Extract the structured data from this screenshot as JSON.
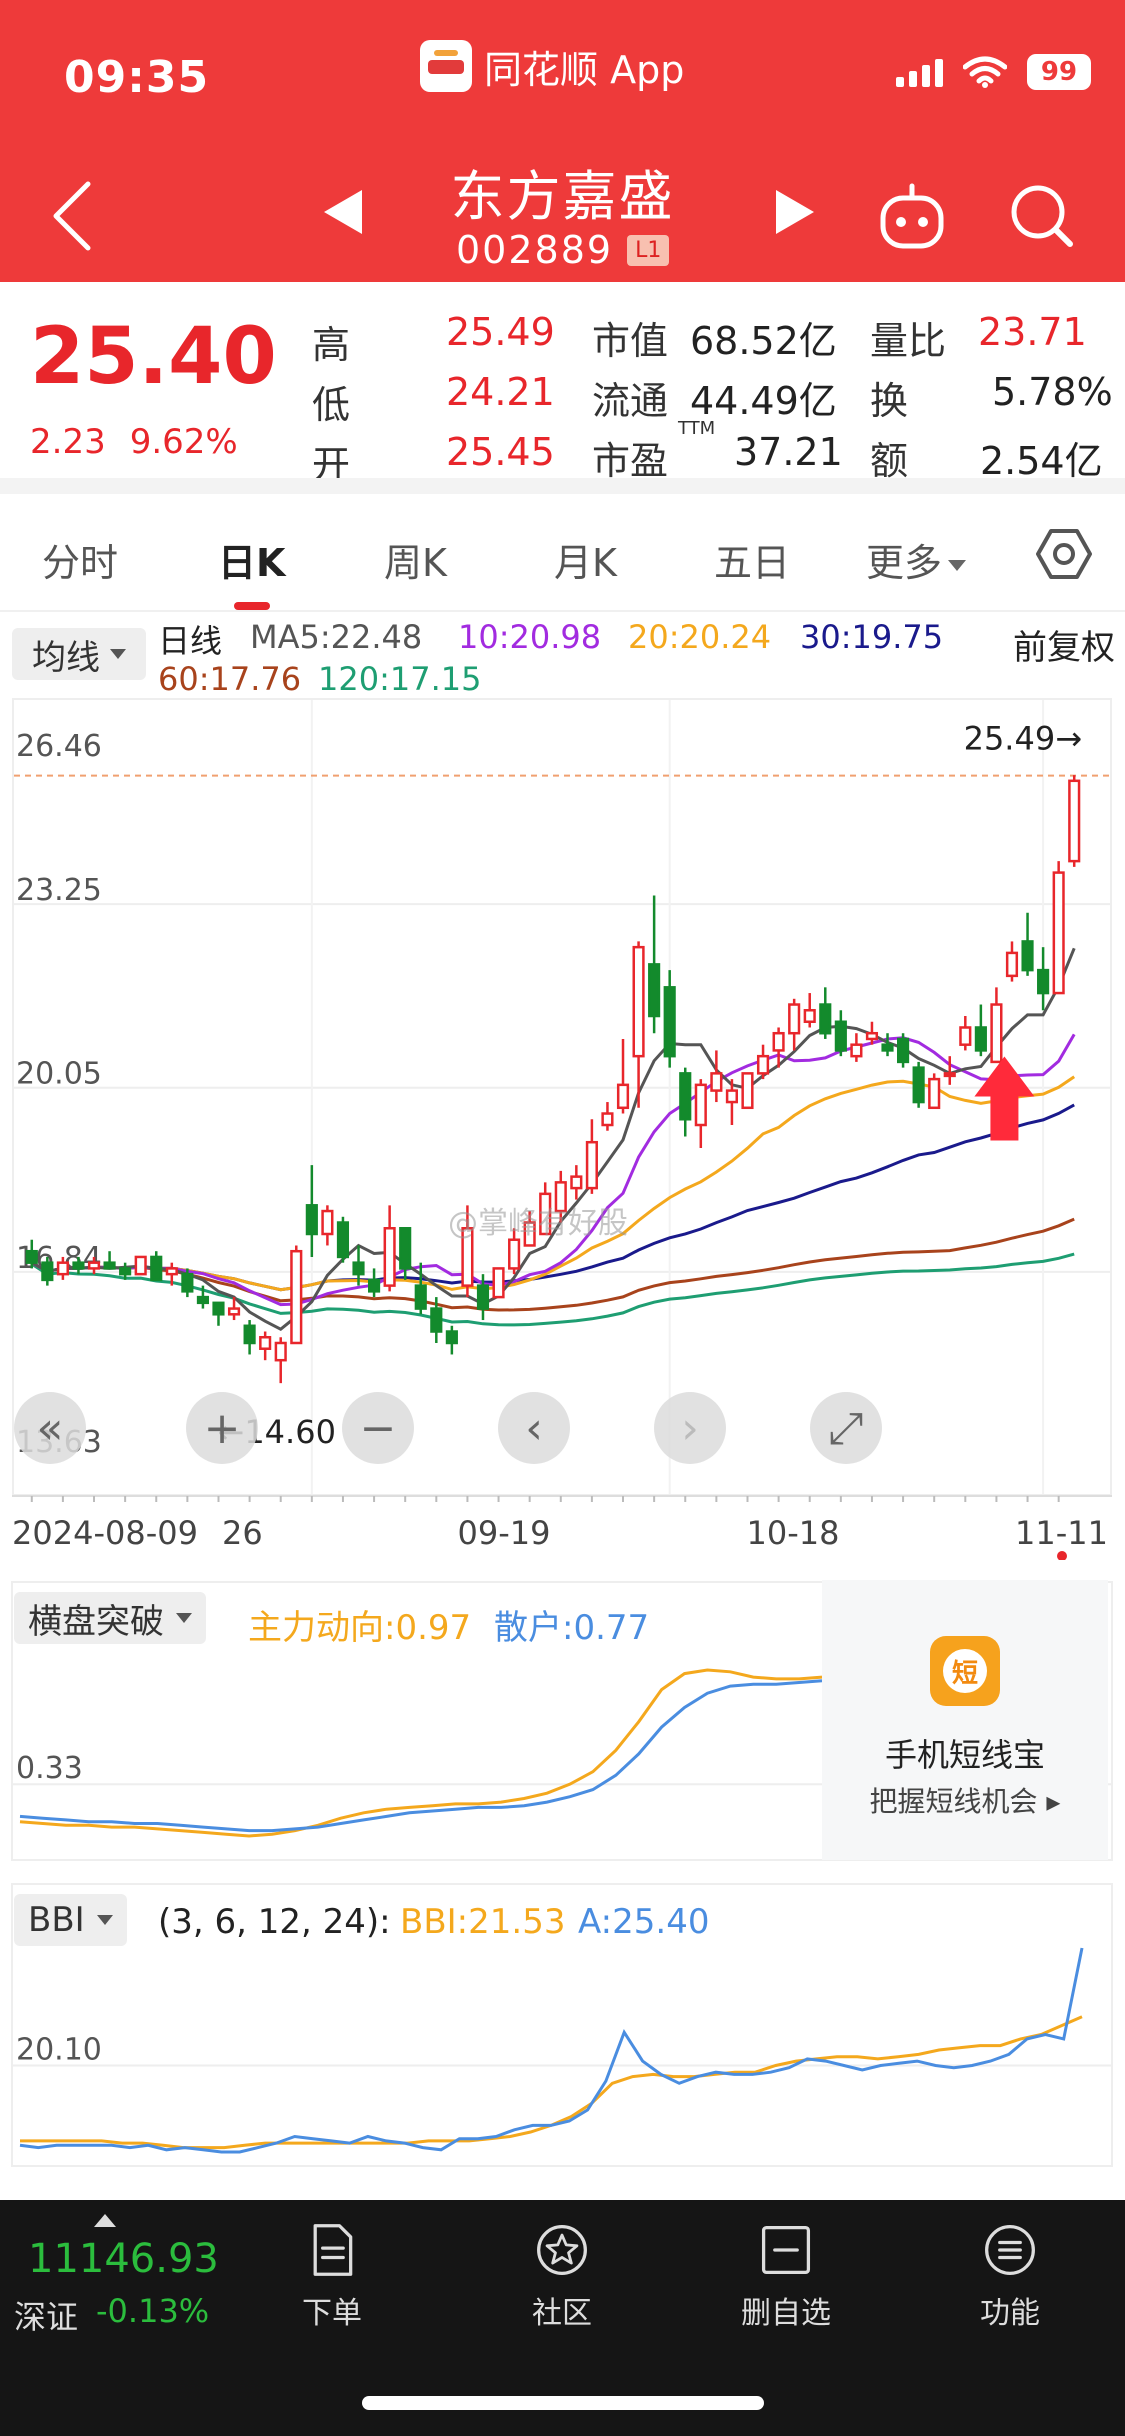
{
  "status": {
    "time": "09:35",
    "app_name": "同花顺 App",
    "battery": "99"
  },
  "stock": {
    "name": "东方嘉盛",
    "code": "002889",
    "level": "L1"
  },
  "quote": {
    "price": "25.40",
    "change": "2.23",
    "change_pct": "9.62%",
    "high_label": "高",
    "high": "25.49",
    "low_label": "低",
    "low": "24.21",
    "open_label": "开",
    "open": "25.45",
    "mktcap_label": "市值",
    "mktcap": "68.52亿",
    "float_label": "流通",
    "float": "44.49亿",
    "pe_label": "市盈",
    "pe_sup": "TTM",
    "pe": "37.21",
    "vol_ratio_label": "量比",
    "vol_ratio": "23.71",
    "turnover_label": "换",
    "turnover": "5.78%",
    "amount_label": "额",
    "amount": "2.54亿"
  },
  "tabs": [
    "分时",
    "日K",
    "周K",
    "月K",
    "五日",
    "更多"
  ],
  "active_tab": "日K",
  "ma_legend": {
    "selector": "均线",
    "period": "日线",
    "ma5": "MA5:22.48",
    "ma10": "10:20.98",
    "ma20": "20:20.24",
    "ma30": "30:19.75",
    "ma60": "60:17.76",
    "ma120": "120:17.15",
    "adjust": "前复权"
  },
  "colors": {
    "up": "#e8262b",
    "down": "#138a2c",
    "ma5": "#555555",
    "ma10": "#a22be0",
    "ma20": "#f4a81d",
    "ma30": "#1a1a8c",
    "ma60": "#a8431c",
    "ma120": "#1e9e72"
  },
  "chart_data": [
    {
      "type": "candlestick",
      "title": "",
      "y_ticks": [
        "26.46",
        "23.25",
        "20.05",
        "16.84",
        "13.63"
      ],
      "ylim": [
        13.63,
        26.46
      ],
      "x_labels": [
        "2024-08-09",
        "26",
        "09-19",
        "10-18",
        "11-11"
      ],
      "max_label": "25.49→",
      "min_label": "←14.60",
      "candles": [
        [
          17.2,
          17.4,
          16.9,
          17.0
        ],
        [
          17.0,
          17.1,
          16.6,
          16.7
        ],
        [
          16.8,
          17.1,
          16.7,
          17.0
        ],
        [
          17.0,
          17.1,
          16.8,
          16.9
        ],
        [
          16.9,
          17.1,
          16.8,
          17.0
        ],
        [
          17.0,
          17.2,
          16.9,
          16.9
        ],
        [
          16.9,
          17.0,
          16.7,
          16.8
        ],
        [
          16.8,
          17.1,
          16.8,
          17.1
        ],
        [
          17.1,
          17.2,
          16.7,
          16.7
        ],
        [
          16.8,
          17.0,
          16.6,
          16.9
        ],
        [
          16.8,
          16.9,
          16.4,
          16.5
        ],
        [
          16.4,
          16.6,
          16.2,
          16.3
        ],
        [
          16.3,
          16.3,
          15.9,
          16.1
        ],
        [
          16.1,
          16.4,
          16.0,
          16.2
        ],
        [
          15.9,
          16.0,
          15.4,
          15.6
        ],
        [
          15.5,
          15.8,
          15.3,
          15.7
        ],
        [
          15.3,
          15.7,
          14.9,
          15.6
        ],
        [
          15.6,
          17.3,
          15.6,
          17.2
        ],
        [
          18.0,
          18.7,
          17.1,
          17.5
        ],
        [
          17.5,
          18.0,
          17.3,
          17.9
        ],
        [
          17.7,
          17.8,
          17.0,
          17.1
        ],
        [
          17.0,
          17.3,
          16.6,
          16.8
        ],
        [
          16.7,
          16.9,
          16.4,
          16.5
        ],
        [
          16.6,
          18.0,
          16.5,
          17.6
        ],
        [
          17.6,
          17.6,
          16.7,
          16.9
        ],
        [
          16.6,
          17.0,
          16.1,
          16.2
        ],
        [
          16.2,
          16.4,
          15.6,
          15.8
        ],
        [
          15.8,
          15.9,
          15.4,
          15.6
        ],
        [
          16.6,
          18.0,
          16.4,
          17.6
        ],
        [
          16.6,
          16.8,
          16.0,
          16.2
        ],
        [
          16.4,
          16.9,
          16.4,
          16.9
        ],
        [
          16.9,
          17.6,
          16.8,
          17.4
        ],
        [
          17.3,
          17.9,
          17.3,
          17.7
        ],
        [
          17.5,
          18.4,
          17.5,
          18.2
        ],
        [
          17.9,
          18.6,
          17.7,
          18.4
        ],
        [
          18.3,
          18.7,
          18.1,
          18.5
        ],
        [
          18.3,
          19.5,
          18.2,
          19.1
        ],
        [
          19.4,
          19.8,
          19.3,
          19.6
        ],
        [
          19.7,
          20.9,
          19.6,
          20.1
        ],
        [
          20.6,
          22.6,
          19.7,
          22.5
        ],
        [
          22.2,
          23.4,
          21.0,
          21.3
        ],
        [
          21.8,
          22.1,
          20.4,
          20.6
        ],
        [
          20.3,
          20.4,
          19.2,
          19.5
        ],
        [
          19.4,
          20.2,
          19.0,
          20.1
        ],
        [
          20.0,
          20.7,
          19.8,
          20.3
        ],
        [
          19.8,
          20.2,
          19.4,
          20.0
        ],
        [
          19.7,
          20.3,
          19.7,
          20.3
        ],
        [
          20.3,
          20.8,
          20.2,
          20.6
        ],
        [
          20.7,
          21.1,
          20.4,
          21.0
        ],
        [
          21.0,
          21.6,
          20.7,
          21.5
        ],
        [
          21.2,
          21.7,
          21.1,
          21.4
        ],
        [
          21.5,
          21.8,
          20.9,
          21.0
        ],
        [
          21.2,
          21.4,
          20.6,
          20.7
        ],
        [
          20.6,
          21.0,
          20.5,
          20.8
        ],
        [
          20.9,
          21.2,
          20.8,
          21.0
        ],
        [
          20.8,
          21.0,
          20.6,
          20.7
        ],
        [
          20.9,
          21.0,
          20.4,
          20.5
        ],
        [
          20.4,
          20.5,
          19.7,
          19.8
        ],
        [
          19.7,
          20.3,
          19.7,
          20.2
        ],
        [
          20.3,
          20.6,
          20.1,
          20.3
        ],
        [
          20.8,
          21.3,
          20.7,
          21.1
        ],
        [
          21.1,
          21.5,
          20.6,
          20.7
        ],
        [
          20.5,
          21.8,
          20.5,
          21.5
        ],
        [
          22.0,
          22.6,
          21.9,
          22.4
        ],
        [
          22.6,
          23.1,
          22.0,
          22.1
        ],
        [
          22.1,
          22.5,
          21.4,
          21.7
        ],
        [
          21.7,
          24.0,
          21.7,
          23.8
        ],
        [
          24.0,
          25.5,
          23.9,
          25.4
        ]
      ],
      "ma_last": {
        "MA5": 22.48,
        "MA10": 20.98,
        "MA20": 20.24,
        "MA30": 19.75,
        "MA60": 17.76,
        "MA120": 17.15
      }
    },
    {
      "type": "line",
      "title": "",
      "indicator": "横盘突破",
      "y_ticks": [
        "0.33"
      ],
      "series": [
        {
          "name": "主力动向",
          "color": "#f4a81d",
          "last": 0.97,
          "values": [
            0.12,
            0.11,
            0.1,
            0.1,
            0.09,
            0.09,
            0.08,
            0.07,
            0.06,
            0.05,
            0.04,
            0.05,
            0.07,
            0.1,
            0.14,
            0.17,
            0.19,
            0.2,
            0.21,
            0.22,
            0.22,
            0.23,
            0.25,
            0.28,
            0.33,
            0.4,
            0.52,
            0.68,
            0.86,
            0.95,
            0.97,
            0.96,
            0.93,
            0.92,
            0.92,
            0.93
          ]
        },
        {
          "name": "散户",
          "color": "#4a8de0",
          "last": 0.77,
          "values": [
            0.15,
            0.14,
            0.13,
            0.12,
            0.12,
            0.11,
            0.11,
            0.1,
            0.09,
            0.08,
            0.07,
            0.07,
            0.08,
            0.09,
            0.11,
            0.13,
            0.15,
            0.17,
            0.18,
            0.19,
            0.2,
            0.2,
            0.21,
            0.23,
            0.26,
            0.3,
            0.38,
            0.5,
            0.65,
            0.76,
            0.84,
            0.88,
            0.89,
            0.89,
            0.9,
            0.91
          ]
        }
      ]
    },
    {
      "type": "line",
      "title": "",
      "indicator": "BBI",
      "params": "(3, 6, 12, 24):",
      "y_ticks": [
        "20.10"
      ],
      "series": [
        {
          "name": "BBI",
          "color": "#f4a81d",
          "last": 21.53,
          "values": [
            16.7,
            16.7,
            16.7,
            16.7,
            16.7,
            16.6,
            16.6,
            16.5,
            16.4,
            16.4,
            16.4,
            16.5,
            16.6,
            16.6,
            16.6,
            16.6,
            16.6,
            16.6,
            16.6,
            16.6,
            16.7,
            16.7,
            16.7,
            16.8,
            16.9,
            17.1,
            17.4,
            17.8,
            18.4,
            19.3,
            19.6,
            19.7,
            19.6,
            19.6,
            19.7,
            19.8,
            19.8,
            20.1,
            20.3,
            20.4,
            20.5,
            20.5,
            20.4,
            20.5,
            20.6,
            20.8,
            20.9,
            21.0,
            21.0,
            21.3,
            21.5,
            21.9,
            22.3
          ]
        },
        {
          "name": "A",
          "color": "#4a8de0",
          "last": 25.4,
          "values": [
            16.5,
            16.4,
            16.5,
            16.5,
            16.5,
            16.5,
            16.4,
            16.5,
            16.3,
            16.4,
            16.3,
            16.2,
            16.2,
            16.4,
            16.6,
            16.9,
            16.8,
            16.7,
            16.6,
            16.9,
            16.7,
            16.6,
            16.4,
            16.3,
            16.8,
            16.8,
            16.9,
            17.2,
            17.4,
            17.4,
            17.6,
            18.1,
            19.4,
            21.6,
            20.3,
            19.7,
            19.3,
            19.6,
            19.8,
            19.7,
            19.7,
            19.8,
            20.0,
            20.4,
            20.3,
            20.1,
            19.9,
            20.1,
            20.2,
            20.3,
            20.1,
            20.0,
            20.1,
            20.3,
            20.6,
            21.3,
            21.5,
            21.3,
            25.4
          ]
        }
      ]
    }
  ],
  "indicators": {
    "ind1": {
      "selector": "横盘突破",
      "label1": "主力动向:0.97",
      "label2": "散户:0.77"
    },
    "ind2": {
      "selector": "BBI",
      "params": "(3, 6, 12, 24):",
      "label1": "BBI:21.53",
      "label2": "A:25.40"
    }
  },
  "promo": {
    "icon_char": "短",
    "title": "手机短线宝",
    "subtitle": "把握短线机会 ▸"
  },
  "watermark": "@掌峰有好股",
  "bottom": {
    "index_value": "11146.93",
    "index_name": "深证",
    "index_change": "-0.13%",
    "nav": [
      "下单",
      "社区",
      "删自选",
      "功能"
    ]
  }
}
